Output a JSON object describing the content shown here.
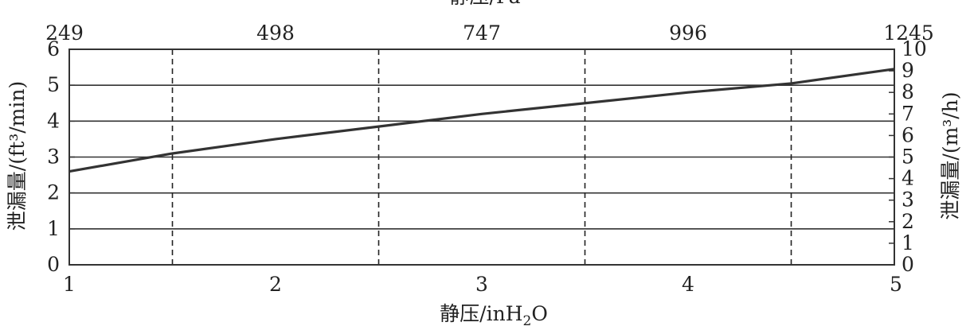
{
  "chart_data": {
    "type": "line",
    "title": "",
    "xlabel_bottom": "静压/inH₂O",
    "xlabel_top": "静压/Pa",
    "ylabel_left": "泄漏量/(ft³/min)",
    "ylabel_right": "泄漏量/(m³/h)",
    "xlim": [
      1,
      5
    ],
    "ylim_left": [
      0,
      6
    ],
    "ylim_right": [
      0,
      10
    ],
    "x_ticks_bottom": [
      "1",
      "2",
      "3",
      "4",
      "5"
    ],
    "x_ticks_top": [
      "249",
      "498",
      "747",
      "996",
      "1245"
    ],
    "y_ticks_left": [
      "0",
      "1",
      "2",
      "3",
      "4",
      "5",
      "6"
    ],
    "y_ticks_right": [
      "0",
      "1",
      "2",
      "3",
      "4",
      "5",
      "6",
      "7",
      "8",
      "9",
      "10"
    ],
    "horizontal_grid_left": [
      1,
      2,
      3,
      4,
      5
    ],
    "vertical_dashed_grid_x": [
      1.5,
      2.5,
      3.5,
      4.5
    ],
    "grid": true,
    "series": [
      {
        "x": [
          1,
          1.5,
          2,
          2.5,
          3,
          3.5,
          4,
          4.5,
          5
        ],
        "y": [
          2.6,
          3.1,
          3.5,
          3.85,
          4.2,
          4.5,
          4.8,
          5.05,
          5.45
        ]
      }
    ]
  }
}
